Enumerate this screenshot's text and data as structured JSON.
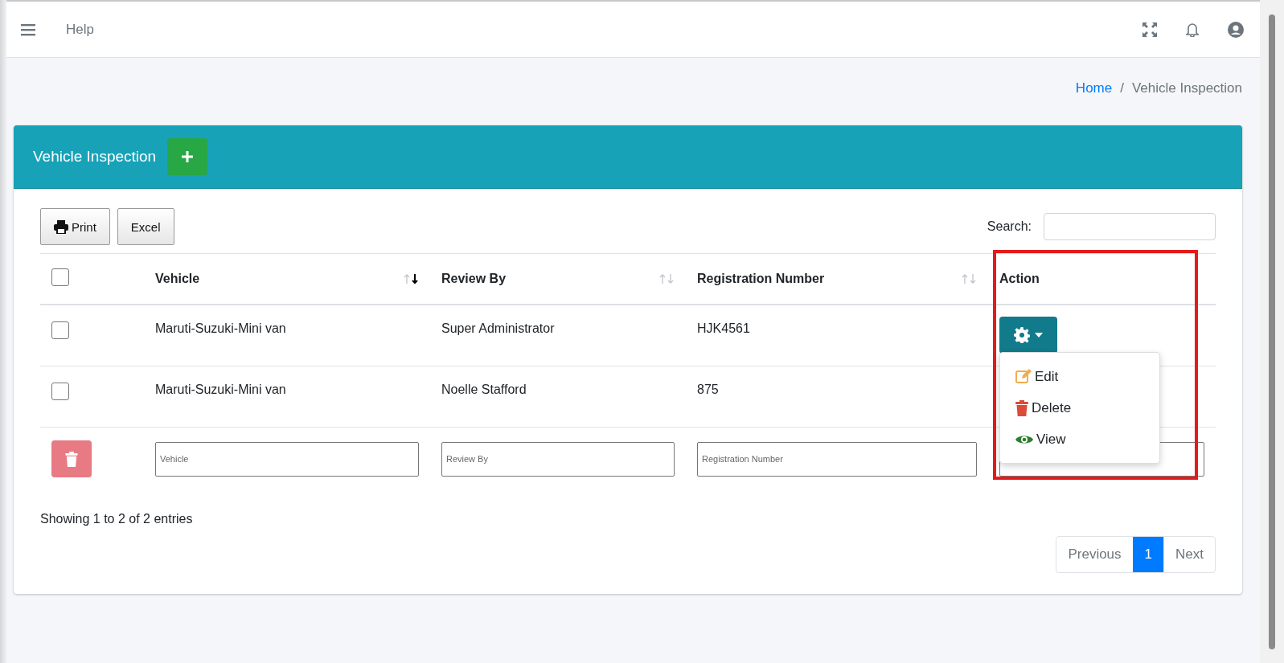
{
  "topbar": {
    "help_link": "Help"
  },
  "breadcrumb": {
    "separator": "/",
    "items": [
      {
        "label": "Home",
        "link": true
      },
      {
        "label": "Vehicle Inspection",
        "link": false
      }
    ]
  },
  "card": {
    "title": "Vehicle Inspection"
  },
  "toolbar": {
    "buttons": [
      {
        "label": "Print",
        "kind": "print"
      },
      {
        "label": "Excel",
        "kind": "plain"
      }
    ],
    "search_label": "Search:"
  },
  "table": {
    "select_all_checked": false,
    "columns": [
      {
        "label": "Vehicle",
        "sortable": true,
        "sorted": true,
        "filter_placeholder": "Vehicle"
      },
      {
        "label": "Review By",
        "sortable": true,
        "sorted": false,
        "filter_placeholder": "Review By"
      },
      {
        "label": "Registration Number",
        "sortable": true,
        "sorted": false,
        "filter_placeholder": "Registration Number"
      },
      {
        "label": "Action",
        "sortable": false
      }
    ],
    "rows": [
      {
        "checked": false,
        "vehicle": "Maruti-Suzuki-Mini van",
        "review_by": "Super Administrator",
        "registration_number": "HJK4561",
        "menu_open": true
      },
      {
        "checked": false,
        "vehicle": "Maruti-Suzuki-Mini van",
        "review_by": "Noelle Stafford",
        "registration_number": "875",
        "menu_open": false
      }
    ]
  },
  "action_menu": [
    {
      "label": "Edit",
      "kind": "edit"
    },
    {
      "label": "Delete",
      "kind": "delete"
    },
    {
      "label": "View",
      "kind": "view"
    }
  ],
  "info": "Showing 1 to 2 of 2 entries",
  "pagination": [
    {
      "label": "Previous",
      "selected": false
    },
    {
      "label": "1",
      "selected": true
    },
    {
      "label": "Next",
      "selected": false
    }
  ]
}
